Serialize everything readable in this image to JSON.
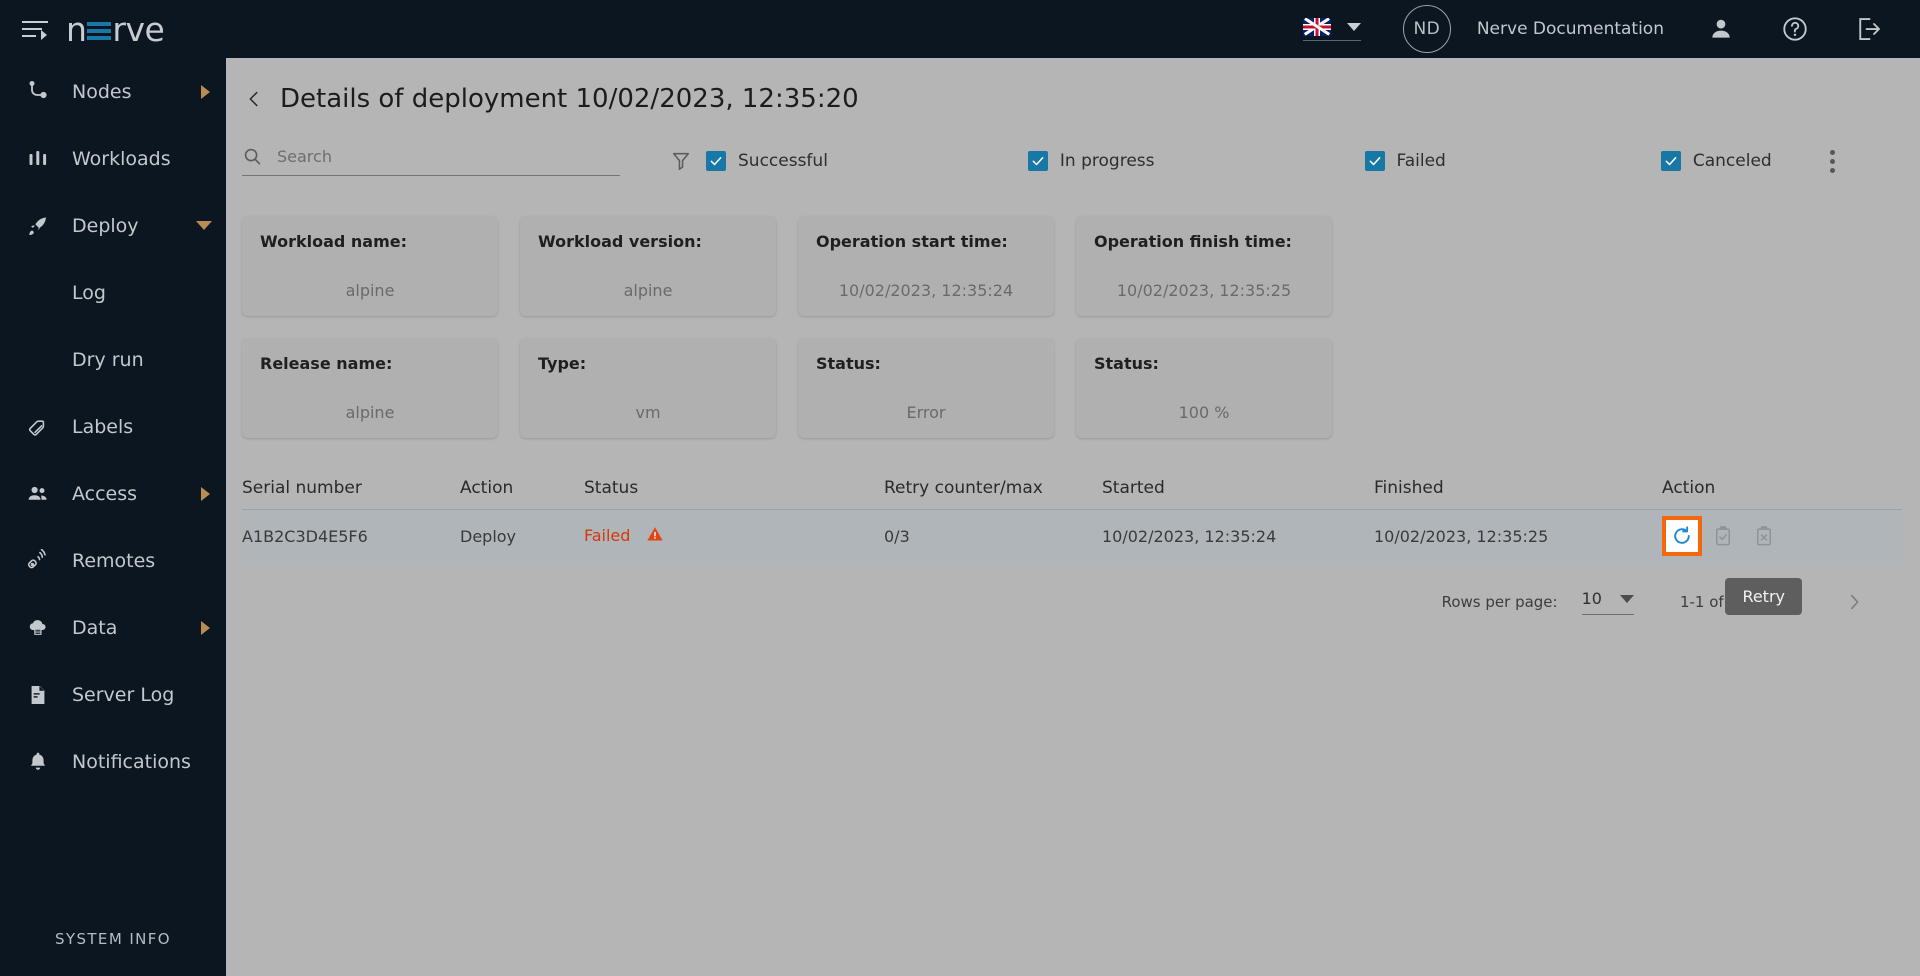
{
  "header": {
    "logo_text_pre": "n",
    "logo_text_post": "rve",
    "menu_icon": "hamburger-menu-icon",
    "language": "English (UK)",
    "avatar_initials": "ND",
    "org_name": "Nerve Documentation",
    "user_icon": "user-icon",
    "help_icon": "help-question-icon",
    "logout_icon": "logout-icon"
  },
  "sidebar": {
    "items": [
      {
        "label": "Nodes",
        "icon": "nodes-icon",
        "expandable": "right"
      },
      {
        "label": "Workloads",
        "icon": "workloads-icon",
        "expandable": "none"
      },
      {
        "label": "Deploy",
        "icon": "deploy-rocket-icon",
        "expandable": "down"
      },
      {
        "label": "Log",
        "icon": "none",
        "expandable": "none",
        "sub": true
      },
      {
        "label": "Dry run",
        "icon": "none",
        "expandable": "none",
        "sub": true
      },
      {
        "label": "Labels",
        "icon": "labels-tag-icon",
        "expandable": "none"
      },
      {
        "label": "Access",
        "icon": "access-users-icon",
        "expandable": "right"
      },
      {
        "label": "Remotes",
        "icon": "remotes-icon",
        "expandable": "none"
      },
      {
        "label": "Data",
        "icon": "data-cloud-icon",
        "expandable": "right"
      },
      {
        "label": "Server Log",
        "icon": "server-log-icon",
        "expandable": "none"
      },
      {
        "label": "Notifications",
        "icon": "bell-icon",
        "expandable": "none"
      }
    ],
    "system_info": "SYSTEM INFO"
  },
  "page": {
    "back_icon": "chevron-left-icon",
    "title": "Details of deployment 10/02/2023, 12:35:20"
  },
  "search": {
    "icon": "search-icon",
    "placeholder": "Search",
    "value": ""
  },
  "filters": {
    "filter_icon": "funnel-filter-icon",
    "kebab_icon": "more-vertical-icon",
    "accent_color": "#1778a6",
    "items": [
      {
        "label": "Successful",
        "checked": true
      },
      {
        "label": "In progress",
        "checked": true
      },
      {
        "label": "Failed",
        "checked": true
      },
      {
        "label": "Canceled",
        "checked": true
      }
    ]
  },
  "cards": [
    {
      "label": "Workload name:",
      "value": "alpine"
    },
    {
      "label": "Workload version:",
      "value": "alpine"
    },
    {
      "label": "Operation start time:",
      "value": "10/02/2023, 12:35:24"
    },
    {
      "label": "Operation finish time:",
      "value": "10/02/2023, 12:35:25"
    },
    {
      "label": "Release name:",
      "value": "alpine"
    },
    {
      "label": "Type:",
      "value": "vm"
    },
    {
      "label": "Status:",
      "value": "Error"
    },
    {
      "label": "Status:",
      "value": "100 %"
    }
  ],
  "table": {
    "columns": [
      "Serial number",
      "Action",
      "Status",
      "Retry counter/max",
      "Started",
      "Finished",
      "Action"
    ],
    "rows": [
      {
        "serial_number": "A1B2C3D4E5F6",
        "action": "Deploy",
        "status": "Failed",
        "status_color": "#d4380d",
        "status_icon": "warning-triangle-icon",
        "retry_counter": "0/3",
        "started": "10/02/2023, 12:35:24",
        "finished": "10/02/2023, 12:35:25",
        "actions": [
          {
            "name": "retry-button",
            "icon": "refresh-retry-icon",
            "enabled": true,
            "highlighted": true,
            "color": "#1e88d2"
          },
          {
            "name": "approve-button",
            "icon": "clipboard-check-icon",
            "enabled": false,
            "highlighted": false,
            "color": "#8f9498"
          },
          {
            "name": "cancel-button",
            "icon": "clipboard-x-icon",
            "enabled": false,
            "highlighted": false,
            "color": "#8f9498"
          }
        ]
      }
    ]
  },
  "pagination": {
    "rows_per_page_label": "Rows per page:",
    "rows_per_page_value": "10",
    "range_text": "1-1 of 1",
    "prev_icon": "chevron-left-icon",
    "next_icon": "chevron-right-icon"
  },
  "tooltip": {
    "text": "Retry"
  }
}
